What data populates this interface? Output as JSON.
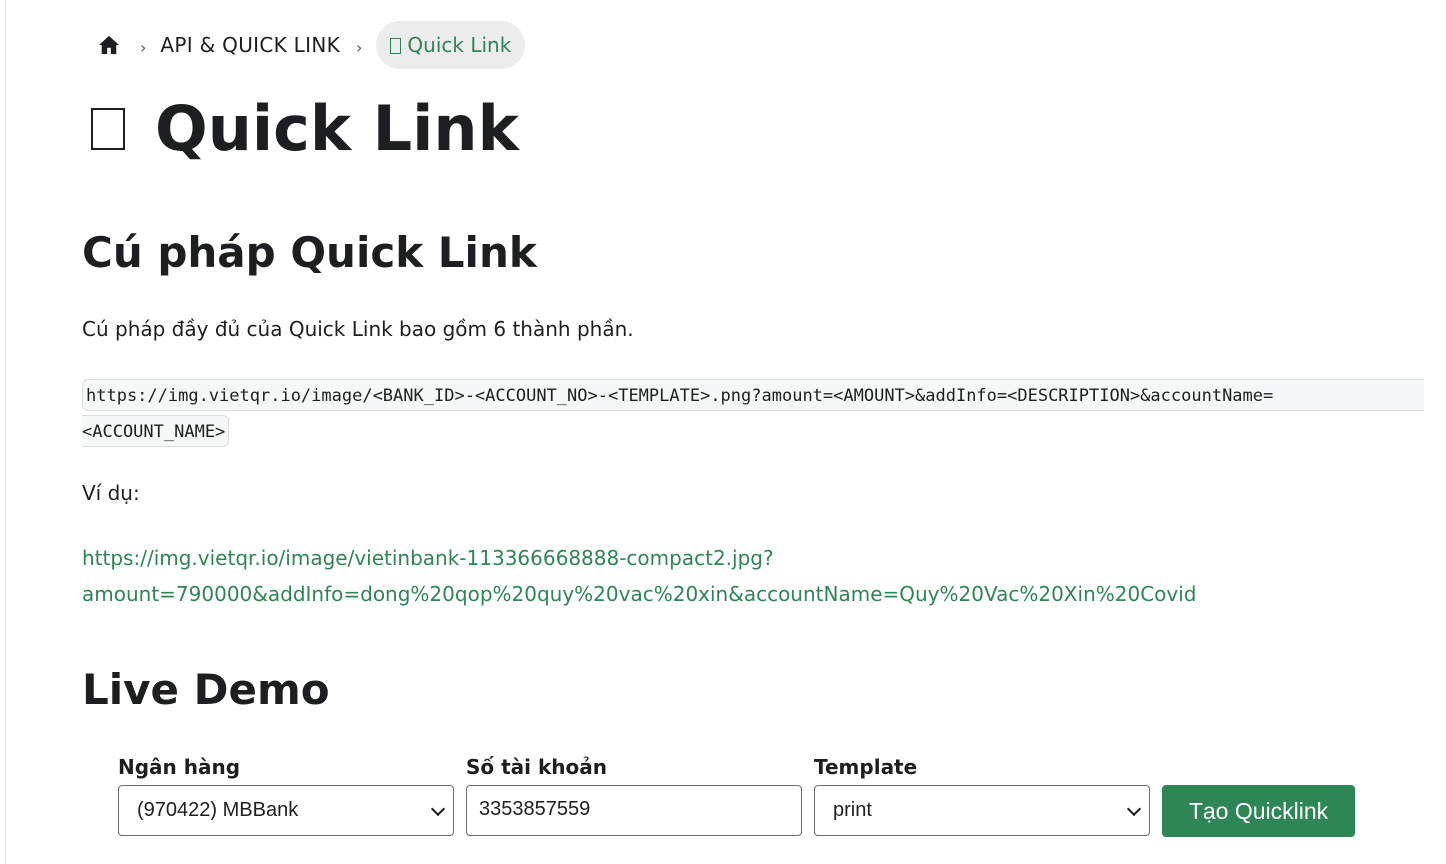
{
  "breadcrumbs": {
    "home_icon": "home-icon",
    "separator": "›",
    "items": [
      {
        "label": "API & QUICK LINK"
      },
      {
        "label": "Quick Link"
      }
    ]
  },
  "page_title": "Quick Link",
  "sections": {
    "syntax": {
      "heading": "Cú pháp Quick Link",
      "description": "Cú pháp đầy đủ của Quick Link bao gồm 6 thành phần.",
      "code_line1": "https://img.vietqr.io/image/<BANK_ID>-<ACCOUNT_NO>-<TEMPLATE>.png?amount=<AMOUNT>&addInfo=<DESCRIPTION>&accountName=",
      "code_line2": "<ACCOUNT_NAME>",
      "example_label": "Ví dụ:",
      "example_link": "https://img.vietqr.io/image/vietinbank-113366668888-compact2.jpg?amount=790000&addInfo=dong%20qop%20quy%20vac%20xin&accountName=Quy%20Vac%20Xin%20Covid"
    },
    "demo": {
      "heading": "Live Demo",
      "bank": {
        "label": "Ngân hàng",
        "value": "(970422) MBBank"
      },
      "account": {
        "label": "Số tài khoản",
        "value": "3353857559"
      },
      "template": {
        "label": "Template",
        "value": "print"
      },
      "submit_label": "Tạo Quicklink"
    }
  },
  "colors": {
    "accent": "#2e8555",
    "text": "#1c1e21",
    "code_bg": "#f6f7f8",
    "breadcrumb_active_bg": "#ececec"
  }
}
